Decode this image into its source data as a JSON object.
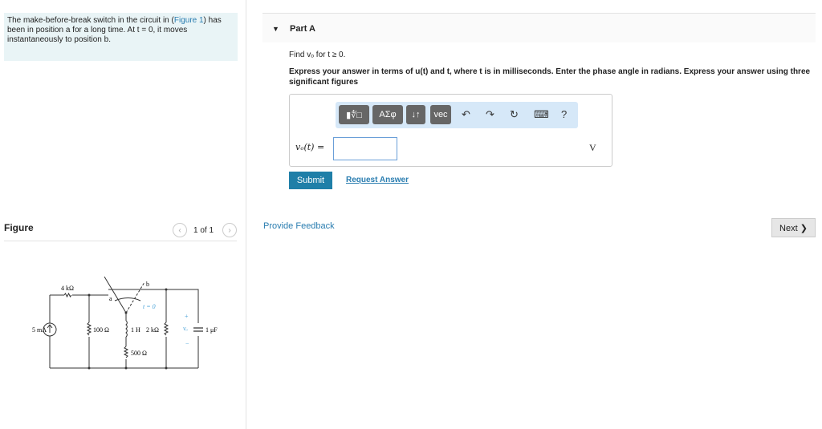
{
  "problem": {
    "text_before": "The make-before-break switch in the circuit in (",
    "figure_link": "Figure 1",
    "text_after": ") has been in position a for a long time. At t = 0, it moves instantaneously to position b."
  },
  "part": {
    "title": "Part A",
    "find": "Find vₒ for t ≥ 0.",
    "instructions": "Express your answer in terms of u(t) and t, where t is in milliseconds. Enter the phase angle in radians. Express your answer using three significant figures"
  },
  "toolbar": {
    "templates": "▮∜□",
    "greek": "ΑΣφ",
    "arrows": "↓↑",
    "vec": "vec",
    "undo": "↶",
    "redo": "↷",
    "reset": "↻",
    "keyboard": "⌨",
    "help": "?"
  },
  "answer": {
    "label": "vₒ(t) =",
    "value": "",
    "unit": "V"
  },
  "buttons": {
    "submit": "Submit",
    "request": "Request Answer",
    "feedback": "Provide Feedback",
    "next": "Next ❯"
  },
  "figure": {
    "label": "Figure",
    "pager": "1 of 1",
    "prev": "‹",
    "next": "›",
    "circuit": {
      "source": "5 mA",
      "r1": "4 kΩ",
      "r2": "100 Ω",
      "inductor": "1 H",
      "r3": "2 kΩ",
      "r4": "500 Ω",
      "cap": "1 μF",
      "node_a": "a",
      "node_b": "b",
      "switch_time": "t = 0",
      "vo": "vₒ",
      "plus": "+",
      "minus": "−"
    }
  }
}
